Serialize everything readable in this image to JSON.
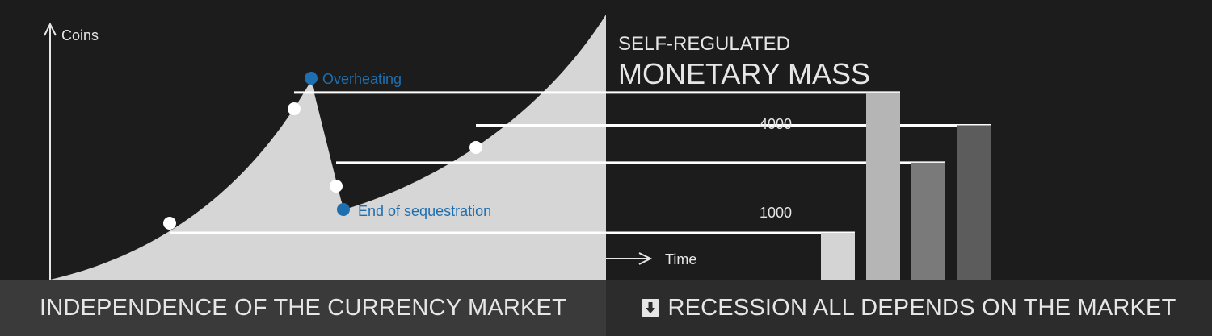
{
  "left_panel": {
    "y_axis_label": "Coins",
    "annotation_peak": "Overheating",
    "annotation_trough": "End of sequestration",
    "footer_text": "INDEPENDENCE OF THE CURRENCY MARKET"
  },
  "right_panel": {
    "heading_line1": "SELF-REGULATED",
    "heading_line2": "MONETARY MASS",
    "x_axis_label": "Time",
    "footer_text": "RECESSION ALL DEPENDS ON THE MARKET",
    "footer_icon": "arrow-down-box-icon"
  },
  "colors": {
    "background": "#1c1c1c",
    "curve_fill": "#d6d6d6",
    "accent_blue": "#1e6fb0",
    "footer_left_bg": "#3a3a3a",
    "footer_right_bg": "#2c2c2c"
  },
  "chart_data": {
    "type": "bar",
    "categories": [
      "",
      "",
      "",
      ""
    ],
    "values": [
      1000,
      4000,
      2500,
      3300
    ],
    "value_labels": [
      "1000",
      "4000"
    ],
    "bar_colors": [
      "#d4d4d4",
      "#b5b5b5",
      "#7a7a7a",
      "#5c5c5c"
    ],
    "ylim": [
      0,
      4600
    ]
  }
}
